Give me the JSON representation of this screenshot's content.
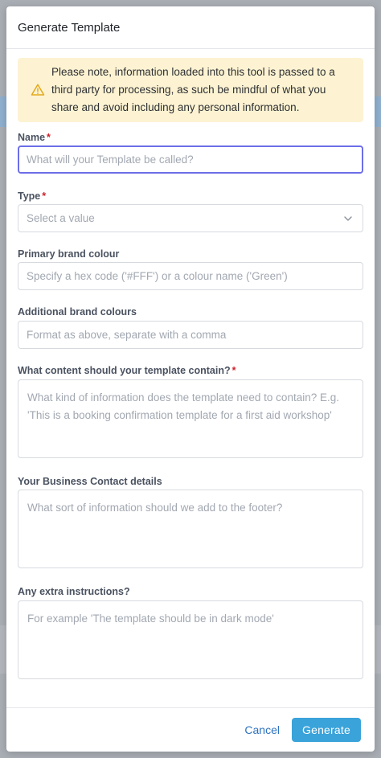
{
  "modal": {
    "title": "Generate Template"
  },
  "alert": {
    "icon": "warning-icon",
    "text": "Please note, information loaded into this tool is passed to a third party for processing, as such be mindful of what you share and avoid including any personal information."
  },
  "fields": {
    "name": {
      "label": "Name",
      "required_mark": "*",
      "placeholder": "What will your Template be called?"
    },
    "type": {
      "label": "Type",
      "required_mark": "*",
      "placeholder": "Select a value",
      "icon": "chevron-down-icon"
    },
    "primary_colour": {
      "label": "Primary brand colour",
      "placeholder": "Specify a hex code ('#FFF') or a colour name ('Green')"
    },
    "additional_colours": {
      "label": "Additional brand colours",
      "placeholder": "Format as above, separate with a comma"
    },
    "content": {
      "label": "What content should your template contain?",
      "required_mark": "*",
      "placeholder": "What kind of information does the template need to contain? E.g. 'This is a booking confirmation template for a first aid workshop'"
    },
    "contact": {
      "label": "Your Business Contact details",
      "placeholder": "What sort of information should we add to the footer?"
    },
    "extra": {
      "label": "Any extra instructions?",
      "placeholder": "For example 'The template should be in dark mode'"
    }
  },
  "footer": {
    "cancel_label": "Cancel",
    "generate_label": "Generate"
  },
  "colors": {
    "accent": "#6c6ee8",
    "primary_button": "#3aa3da",
    "link": "#2e72c0",
    "alert_bg": "#fdf3d2",
    "required": "#d0202a"
  }
}
